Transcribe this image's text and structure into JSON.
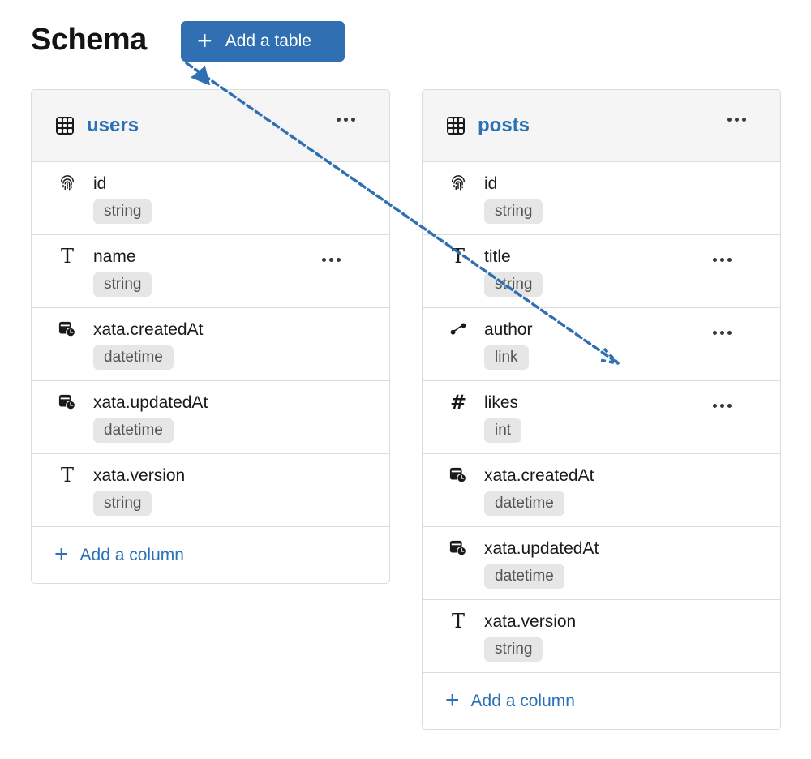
{
  "page": {
    "title": "Schema"
  },
  "toolbar": {
    "add_table_label": "Add a table",
    "add_table_icon": "plus-icon"
  },
  "tables": [
    {
      "name": "users",
      "columns": [
        {
          "name": "id",
          "type": "string",
          "icon": "fingerprint-icon",
          "menu": false
        },
        {
          "name": "name",
          "type": "string",
          "icon": "text-icon",
          "menu": true
        },
        {
          "name": "xata.createdAt",
          "type": "datetime",
          "icon": "calendar-clock-icon",
          "menu": false
        },
        {
          "name": "xata.updatedAt",
          "type": "datetime",
          "icon": "calendar-clock-icon",
          "menu": false
        },
        {
          "name": "xata.version",
          "type": "string",
          "icon": "text-icon",
          "menu": false
        }
      ],
      "add_column_label": "Add a column"
    },
    {
      "name": "posts",
      "columns": [
        {
          "name": "id",
          "type": "string",
          "icon": "fingerprint-icon",
          "menu": false
        },
        {
          "name": "title",
          "type": "string",
          "icon": "text-icon",
          "menu": true
        },
        {
          "name": "author",
          "type": "link",
          "icon": "link-icon",
          "menu": true
        },
        {
          "name": "likes",
          "type": "int",
          "icon": "hash-icon",
          "menu": true
        },
        {
          "name": "xata.createdAt",
          "type": "datetime",
          "icon": "calendar-clock-icon",
          "menu": false
        },
        {
          "name": "xata.updatedAt",
          "type": "datetime",
          "icon": "calendar-clock-icon",
          "menu": false
        },
        {
          "name": "xata.version",
          "type": "string",
          "icon": "text-icon",
          "menu": false
        }
      ],
      "add_column_label": "Add a column"
    }
  ],
  "colors": {
    "accent": "#2a72b5",
    "button": "#2f6fb2",
    "badge_bg": "#e6e6e6",
    "header_bg": "#f5f5f5",
    "arrow": "#2f6fb2"
  }
}
